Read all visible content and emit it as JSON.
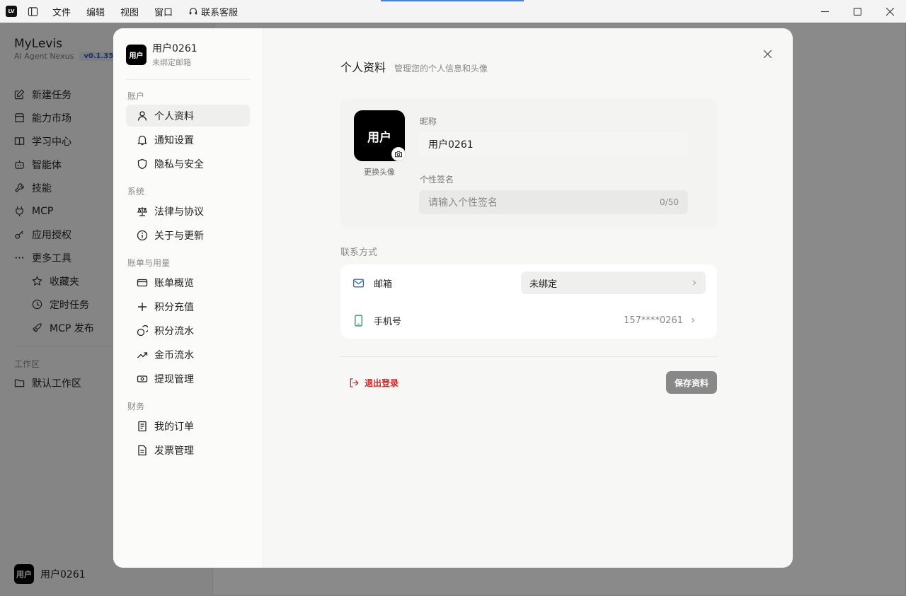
{
  "titlebar": {
    "app_badge": "LV",
    "menus": [
      "文件",
      "编辑",
      "视图",
      "窗口"
    ],
    "support": "联系客服"
  },
  "app": {
    "name": "MyLevis",
    "subtitle": "AI Agent Nexus",
    "version": "v0.1.35",
    "nav": [
      {
        "label": "新建任务",
        "icon": "edit-icon"
      },
      {
        "label": "能力市场",
        "icon": "store-icon"
      },
      {
        "label": "学习中心",
        "icon": "book-icon"
      },
      {
        "label": "智能体",
        "icon": "bot-icon"
      },
      {
        "label": "技能",
        "icon": "wrench-icon"
      },
      {
        "label": "MCP",
        "icon": "plug-icon"
      },
      {
        "label": "应用授权",
        "icon": "key-icon"
      },
      {
        "label": "更多工具",
        "icon": "more-icon"
      }
    ],
    "more_tools": [
      {
        "label": "收藏夹",
        "icon": "star-icon"
      },
      {
        "label": "定时任务",
        "icon": "clock-icon"
      },
      {
        "label": "MCP 发布",
        "icon": "rocket-icon"
      }
    ],
    "workspace_label": "工作区",
    "workspace": "默认工作区",
    "user": {
      "avatar": "用户",
      "name": "用户0261"
    }
  },
  "modal": {
    "user": {
      "avatar": "用户",
      "name": "用户0261",
      "email_status": "未绑定邮箱"
    },
    "sections": [
      {
        "label": "账户",
        "items": [
          {
            "label": "个人资料",
            "icon": "user-icon",
            "active": true
          },
          {
            "label": "通知设置",
            "icon": "bell-icon"
          },
          {
            "label": "隐私与安全",
            "icon": "shield-icon"
          }
        ]
      },
      {
        "label": "系统",
        "items": [
          {
            "label": "法律与协议",
            "icon": "scale-icon"
          },
          {
            "label": "关于与更新",
            "icon": "info-icon"
          }
        ]
      },
      {
        "label": "账单与用量",
        "items": [
          {
            "label": "账单概览",
            "icon": "card-icon"
          },
          {
            "label": "积分充值",
            "icon": "plus-icon"
          },
          {
            "label": "积分流水",
            "icon": "coins-icon"
          },
          {
            "label": "金币流水",
            "icon": "trend-icon"
          },
          {
            "label": "提现管理",
            "icon": "cash-icon"
          }
        ]
      },
      {
        "label": "财务",
        "items": [
          {
            "label": "我的订单",
            "icon": "order-icon"
          },
          {
            "label": "发票管理",
            "icon": "invoice-icon"
          }
        ]
      }
    ],
    "header": {
      "title": "个人资料",
      "subtitle": "管理您的个人信息和头像"
    },
    "profile": {
      "avatar_text": "用户",
      "change_avatar": "更换头像",
      "nickname_label": "昵称",
      "nickname_value": "用户0261",
      "signature_label": "个性签名",
      "signature_placeholder": "请输入个性签名",
      "signature_count": "0/50"
    },
    "contact": {
      "label": "联系方式",
      "email_label": "邮箱",
      "email_value": "未绑定",
      "phone_label": "手机号",
      "phone_value": "157****0261"
    },
    "logout": "退出登录",
    "save": "保存资料"
  }
}
